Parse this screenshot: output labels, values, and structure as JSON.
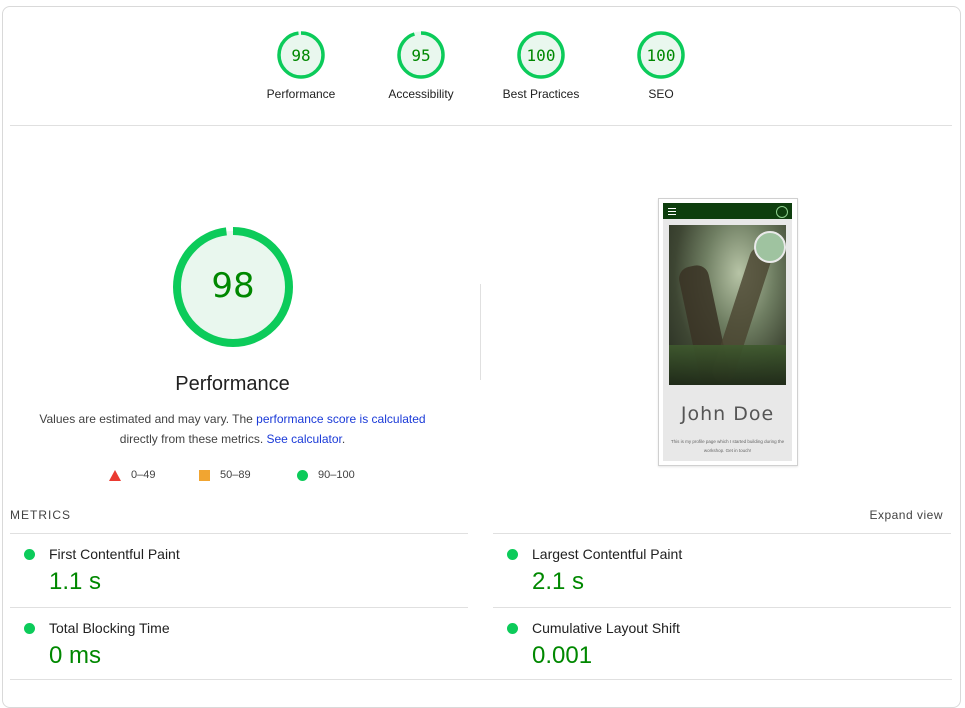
{
  "categories": [
    {
      "score": "98",
      "label": "Performance",
      "color": "#0ccb5a"
    },
    {
      "score": "95",
      "label": "Accessibility",
      "color": "#0ccb5a"
    },
    {
      "score": "100",
      "label": "Best Practices",
      "color": "#0ccb5a"
    },
    {
      "score": "100",
      "label": "SEO",
      "color": "#0ccb5a"
    }
  ],
  "main": {
    "score": "98",
    "score_fraction": 0.98,
    "title": "Performance",
    "desc_prefix": "Values are estimated and may vary. The ",
    "desc_link1": "performance score is calculated",
    "desc_middle": "directly from these metrics. ",
    "desc_link2": "See calculator",
    "desc_suffix": ".",
    "legend": {
      "poor": "0–49",
      "average": "50–89",
      "good": "90–100"
    }
  },
  "screenshot": {
    "name": "John Doe",
    "text": "This is my profile page which I started building during the workshop. Get in touch!"
  },
  "metrics": {
    "header": "METRICS",
    "expand_label": "Expand view",
    "left": [
      {
        "name": "First Contentful Paint",
        "value": "1.1 s"
      },
      {
        "name": "Total Blocking Time",
        "value": "0 ms"
      }
    ],
    "right": [
      {
        "name": "Largest Contentful Paint",
        "value": "2.1 s"
      },
      {
        "name": "Cumulative Layout Shift",
        "value": "0.001"
      }
    ]
  },
  "colors": {
    "pass": "#0ccb5a",
    "pass_text": "#008800",
    "fail": "#ea3a31",
    "average": "#f1a531",
    "link": "#1a3ad8"
  }
}
